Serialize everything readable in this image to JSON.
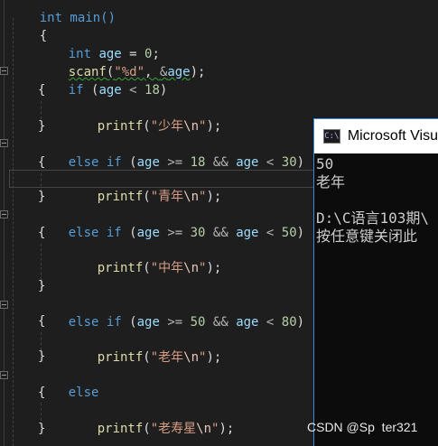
{
  "editor": {
    "lines": {
      "signature": "int main()",
      "open_brace": "{",
      "decl": {
        "type": "int",
        "var": "age",
        "eq": " = ",
        "val": "0",
        "end": ";"
      },
      "scanf": {
        "fn": "scanf",
        "open": "(",
        "fmt": "\"%d\"",
        "comma": ", ",
        "amp": "&",
        "var": "age",
        "close": ");"
      },
      "if1": {
        "kw": "if",
        "open": " (",
        "var": "age",
        "op": " < ",
        "num": "18",
        "close": ")"
      },
      "b1_open": "{",
      "p1": {
        "fn": "printf",
        "open": "(",
        "q1": "\"少年",
        "esc": "\\n",
        "q2": "\"",
        "close": ");"
      },
      "b1_close": "}",
      "if2": {
        "kw": "else if",
        "open": " (",
        "var1": "age",
        "op1": " >= ",
        "num1": "18",
        "and": " && ",
        "var2": "age",
        "op2": " < ",
        "num2": "30",
        "close": ")"
      },
      "b2_open": "{",
      "p2": {
        "fn": "printf",
        "open": "(",
        "q1": "\"青年",
        "esc": "\\n",
        "q2": "\"",
        "close": ");"
      },
      "b2_close": "}",
      "if3": {
        "kw": "else if",
        "open": " (",
        "var1": "age",
        "op1": " >= ",
        "num1": "30",
        "and": " && ",
        "var2": "age",
        "op2": " < ",
        "num2": "50",
        "close": ")"
      },
      "b3_open": "{",
      "p3": {
        "fn": "printf",
        "open": "(",
        "q1": "\"中年",
        "esc": "\\n",
        "q2": "\"",
        "close": ");"
      },
      "b3_close": "}",
      "if4": {
        "kw": "else if",
        "open": " (",
        "var1": "age",
        "op1": " >= ",
        "num1": "50",
        "and": " && ",
        "var2": "age",
        "op2": " < ",
        "num2": "80",
        "close": ")"
      },
      "b4_open": "{",
      "p4": {
        "fn": "printf",
        "open": "(",
        "q1": "\"老年",
        "esc": "\\n",
        "q2": "\"",
        "close": ");"
      },
      "b4_close": "}",
      "else": "else",
      "b5_open": "{",
      "p5": {
        "fn": "printf",
        "open": "(",
        "q1": "\"老寿星",
        "esc": "\\n",
        "q2": "\"",
        "close": ");"
      },
      "b5_close": "}"
    }
  },
  "console": {
    "title": "Microsoft Visu",
    "icon_text": "C:\\",
    "output": "50\n老年\n\nD:\\C语言103期\\\n按任意键关闭此"
  },
  "watermark": "CSDN @Sp  ter321"
}
